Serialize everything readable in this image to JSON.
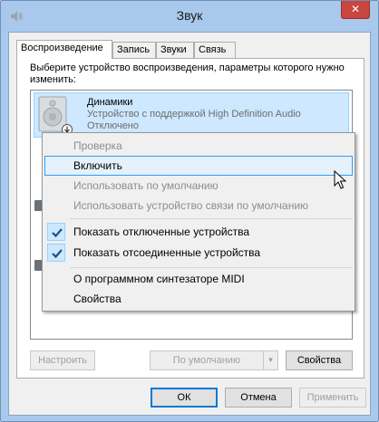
{
  "window": {
    "title": "Звук",
    "close_glyph": "✕"
  },
  "tabs": [
    {
      "label": "Воспроизведение",
      "active": true
    },
    {
      "label": "Запись",
      "active": false
    },
    {
      "label": "Звуки",
      "active": false
    },
    {
      "label": "Связь",
      "active": false
    }
  ],
  "panel": {
    "instructions": "Выберите устройство воспроизведения, параметры которого нужно изменить:"
  },
  "device": {
    "name": "Динамики",
    "description": "Устройство с поддержкой High Definition Audio",
    "status": "Отключено",
    "icon": "speaker-icon",
    "overlay_icon": "disabled-down-arrow-icon"
  },
  "context_menu": {
    "items": [
      {
        "label": "Проверка",
        "disabled": true,
        "checked": false
      },
      {
        "label": "Включить",
        "disabled": false,
        "checked": false,
        "hovered": true
      },
      {
        "label": "Использовать по умолчанию",
        "disabled": true,
        "checked": false
      },
      {
        "label": "Использовать устройство связи по умолчанию",
        "disabled": true,
        "checked": false
      },
      {
        "label": "Показать отключенные устройства",
        "disabled": false,
        "checked": true
      },
      {
        "label": "Показать отсоединенные устройства",
        "disabled": false,
        "checked": true
      },
      {
        "label": "О программном синтезаторе MIDI",
        "disabled": false,
        "checked": false
      },
      {
        "label": "Свойства",
        "disabled": false,
        "checked": false
      }
    ]
  },
  "panel_buttons": {
    "configure": "Настроить",
    "set_default": "По умолчанию",
    "properties": "Свойства"
  },
  "dialog_buttons": {
    "ok": "ОК",
    "cancel": "Отмена",
    "apply": "Применить"
  },
  "colors": {
    "selection": "#cde8ff",
    "menu_hover_border": "#3399ff",
    "check_color": "#1d4e89",
    "close_button": "#c7463d"
  }
}
